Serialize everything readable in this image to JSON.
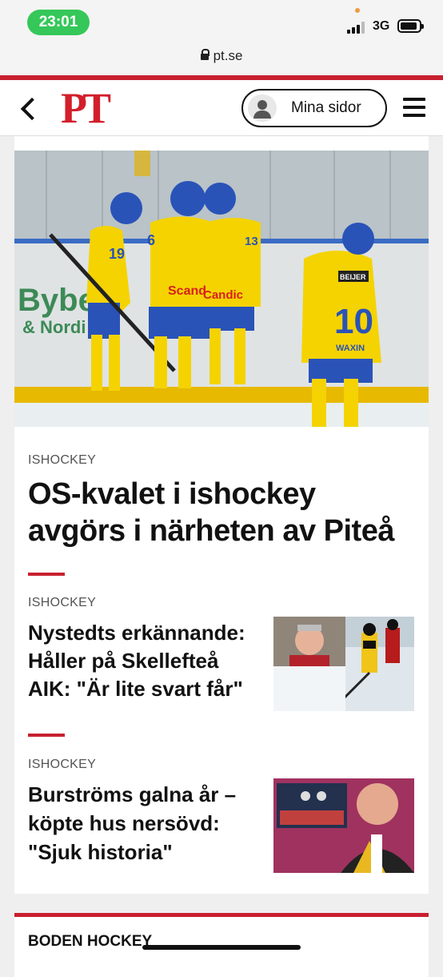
{
  "status": {
    "time": "23:01",
    "network": "3G"
  },
  "browser": {
    "url": "pt.se"
  },
  "header": {
    "logo": "PT",
    "account_label": "Mina sidor"
  },
  "hero": {
    "image_desc": "hockey-players-celebrating",
    "jerseys": [
      "19",
      "6",
      "13",
      "10"
    ],
    "sponsor_text": [
      "Byber",
      "& Nordi",
      "Scandic",
      "Candic",
      "BEIJER",
      "WAXIN"
    ]
  },
  "articles": [
    {
      "tag": "ISHOCKEY",
      "title": "OS-kvalet i ishockey avgörs i närheten av Piteå"
    },
    {
      "tag": "ISHOCKEY",
      "title": "Nystedts erkännande: Håller på Skellefteå AIK: \"Är lite svart får\""
    },
    {
      "tag": "ISHOCKEY",
      "title": "Burströms galna år – köpte hus nersövd: \"Sjuk historia\""
    }
  ],
  "section": {
    "title": "BODEN HOCKEY"
  },
  "colors": {
    "brand_red": "#c8202f",
    "status_green": "#35c759"
  }
}
